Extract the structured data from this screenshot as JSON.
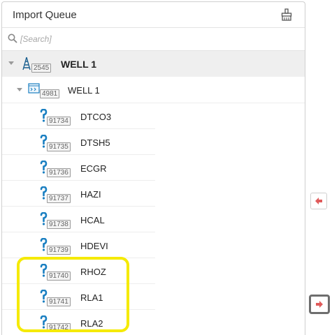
{
  "panel": {
    "title": "Import Queue",
    "clear_icon": "clear-queue-icon"
  },
  "search": {
    "placeholder": "[Search]",
    "value": ""
  },
  "tree": {
    "root": {
      "badge": "2545",
      "label": "WELL 1",
      "icon": "derrick-icon"
    },
    "well": {
      "badge": "4981",
      "label": "WELL 1",
      "icon": "log-grid-icon"
    },
    "curves": [
      {
        "badge": "91734",
        "label": "DTCO3"
      },
      {
        "badge": "91735",
        "label": "DTSH5"
      },
      {
        "badge": "91736",
        "label": "ECGR"
      },
      {
        "badge": "91737",
        "label": "HAZI"
      },
      {
        "badge": "91738",
        "label": "HCAL"
      },
      {
        "badge": "91739",
        "label": "HDEVI"
      },
      {
        "badge": "91740",
        "label": "RHOZ"
      },
      {
        "badge": "91741",
        "label": "RLA1"
      },
      {
        "badge": "91742",
        "label": "RLA2"
      }
    ]
  },
  "side_buttons": {
    "move_left": "arrow-left-icon",
    "move_right": "arrow-right-icon"
  },
  "colors": {
    "highlight": "#f5ea00",
    "curve_icon": "#1a7fc1",
    "arrow": "#e05a5a"
  }
}
